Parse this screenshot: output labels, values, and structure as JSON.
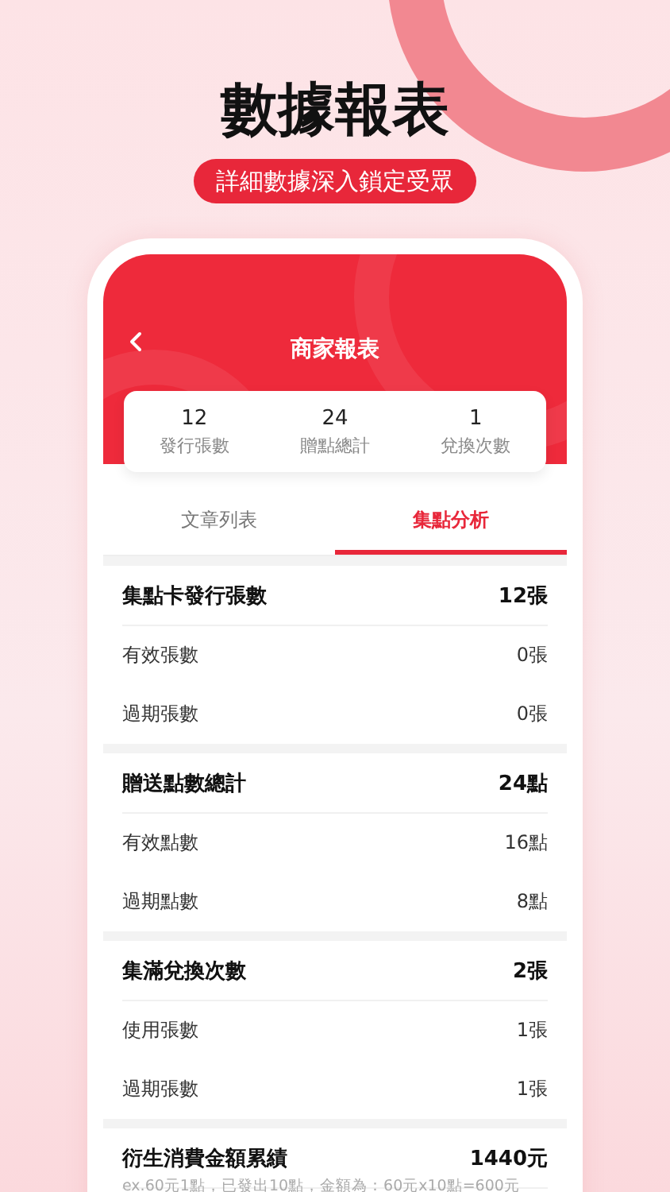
{
  "headline": "數據報表",
  "subtitle": "詳細數據深入鎖定受眾",
  "screen": {
    "title": "商家報表",
    "stats": [
      {
        "value": "12",
        "label": "發行張數"
      },
      {
        "value": "24",
        "label": "贈點總計"
      },
      {
        "value": "1",
        "label": "兌換次數"
      }
    ],
    "tabs": [
      {
        "label": "文章列表",
        "selected": false
      },
      {
        "label": "集點分析",
        "selected": true
      }
    ],
    "sections": [
      {
        "title": "集點卡發行張數",
        "value": "12張",
        "rows": [
          {
            "label": "有效張數",
            "value": "0張"
          },
          {
            "label": "過期張數",
            "value": "0張"
          }
        ]
      },
      {
        "title": "贈送點數總計",
        "value": "24點",
        "rows": [
          {
            "label": "有效點數",
            "value": "16點"
          },
          {
            "label": "過期點數",
            "value": "8點"
          }
        ]
      },
      {
        "title": "集滿兌換次數",
        "value": "2張",
        "rows": [
          {
            "label": "使用張數",
            "value": "1張"
          },
          {
            "label": "過期張數",
            "value": "1張"
          }
        ]
      },
      {
        "title": "衍生消費金額累績",
        "value": "1440元",
        "note": "ex.60元1點，已發出10點，金額為：60元x10點=600元"
      }
    ]
  }
}
